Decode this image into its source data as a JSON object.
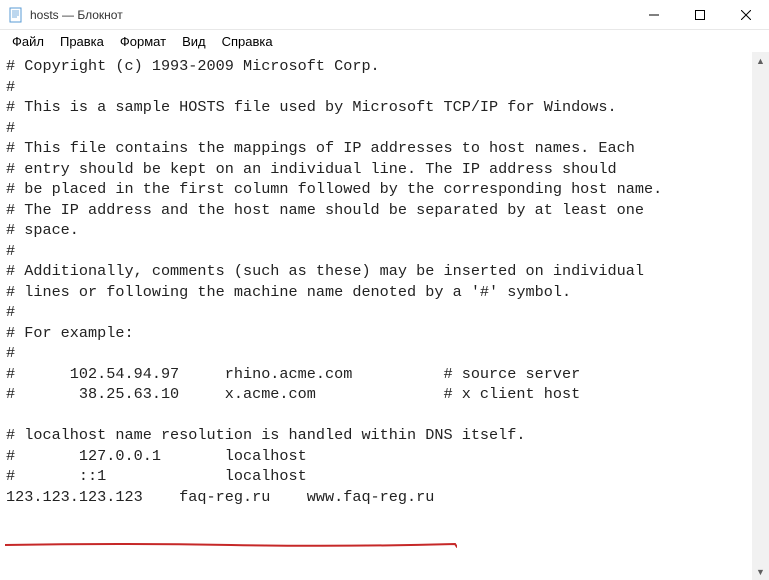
{
  "window": {
    "title": "hosts — Блокнот"
  },
  "menu": {
    "file": "Файл",
    "edit": "Правка",
    "format": "Формат",
    "view": "Вид",
    "help": "Справка"
  },
  "editor": {
    "content": "# Copyright (c) 1993-2009 Microsoft Corp.\n#\n# This is a sample HOSTS file used by Microsoft TCP/IP for Windows.\n#\n# This file contains the mappings of IP addresses to host names. Each\n# entry should be kept on an individual line. The IP address should\n# be placed in the first column followed by the corresponding host name.\n# The IP address and the host name should be separated by at least one\n# space.\n#\n# Additionally, comments (such as these) may be inserted on individual\n# lines or following the machine name denoted by a '#' symbol.\n#\n# For example:\n#\n#      102.54.94.97     rhino.acme.com          # source server\n#       38.25.63.10     x.acme.com              # x client host\n\n# localhost name resolution is handled within DNS itself.\n#       127.0.0.1       localhost\n#       ::1             localhost\n123.123.123.123    faq-reg.ru    www.faq-reg.ru"
  },
  "annotation": {
    "underline_color": "#c62828"
  },
  "scrollbar": {
    "up": "▲",
    "down": "▼"
  }
}
